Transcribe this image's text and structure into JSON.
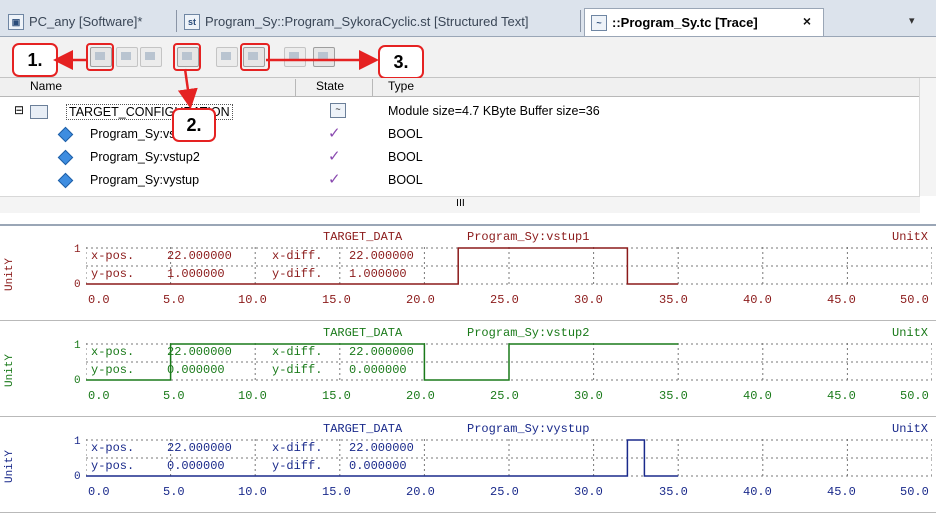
{
  "tabs": [
    {
      "label": "PC_any [Software]*",
      "icon": "project-icon"
    },
    {
      "label": "Program_Sy::Program_SykoraCyclic.st [Structured Text]",
      "icon": "st-file-icon",
      "icon_text": "st"
    },
    {
      "label": "::Program_Sy.tc [Trace]",
      "icon": "trace-file-icon",
      "active": true
    }
  ],
  "tab_close": "×",
  "tabs_dropdown": "▾",
  "callouts": {
    "one": "1.",
    "two": "2.",
    "three": "3."
  },
  "tree": {
    "headers": {
      "name": "Name",
      "state": "State",
      "type": "Type"
    },
    "root": {
      "name": "TARGET_CONFIGURATION",
      "info": "Module size=4.7 KByte   Buffer size=36",
      "expander": "⊟"
    },
    "rows": [
      {
        "name": "Program_Sy:vstup1",
        "type": "BOOL",
        "state": "✓"
      },
      {
        "name": "Program_Sy:vstup2",
        "type": "BOOL",
        "state": "✓"
      },
      {
        "name": "Program_Sy:vystup",
        "type": "BOOL",
        "state": "✓"
      }
    ],
    "hscroll_thumb": "III"
  },
  "trace": {
    "target": "TARGET_DATA",
    "unit_x": "UnitX",
    "unit_y": "UnitY",
    "y_top": "1",
    "y_bottom": "0",
    "x_ticks": [
      "0.0",
      "5.0",
      "10.0",
      "15.0",
      "20.0",
      "25.0",
      "30.0",
      "35.0",
      "40.0",
      "45.0",
      "50.0"
    ],
    "panels": [
      {
        "variable": "Program_Sy:vstup1",
        "color": "#8b1a1a",
        "readout": {
          "x_pos": "22.000000",
          "y_pos": "1.000000",
          "x_diff": "22.000000",
          "y_diff": "1.000000"
        },
        "signal": [
          [
            0,
            0
          ],
          [
            22,
            0
          ],
          [
            22,
            1
          ],
          [
            32,
            1
          ],
          [
            32,
            0
          ],
          [
            35,
            0
          ]
        ]
      },
      {
        "variable": "Program_Sy:vstup2",
        "color": "#1a7a1a",
        "readout": {
          "x_pos": "22.000000",
          "y_pos": "0.000000",
          "x_diff": "22.000000",
          "y_diff": "0.000000"
        },
        "signal": [
          [
            0,
            0
          ],
          [
            5,
            0
          ],
          [
            5,
            1
          ],
          [
            20,
            1
          ],
          [
            20,
            0
          ],
          [
            25,
            0
          ],
          [
            25,
            1
          ],
          [
            35,
            1
          ]
        ]
      },
      {
        "variable": "Program_Sy:vystup",
        "color": "#1a2a8b",
        "readout": {
          "x_pos": "22.000000",
          "y_pos": "0.000000",
          "x_diff": "22.000000",
          "y_diff": "0.000000"
        },
        "signal": [
          [
            0,
            0
          ],
          [
            32,
            0
          ],
          [
            32,
            1
          ],
          [
            33,
            1
          ],
          [
            33,
            0
          ],
          [
            35,
            0
          ]
        ]
      }
    ],
    "labels": {
      "x_pos": "x-pos.",
      "y_pos": "y-pos.",
      "x_diff": "x-diff.",
      "y_diff": "y-diff."
    }
  }
}
